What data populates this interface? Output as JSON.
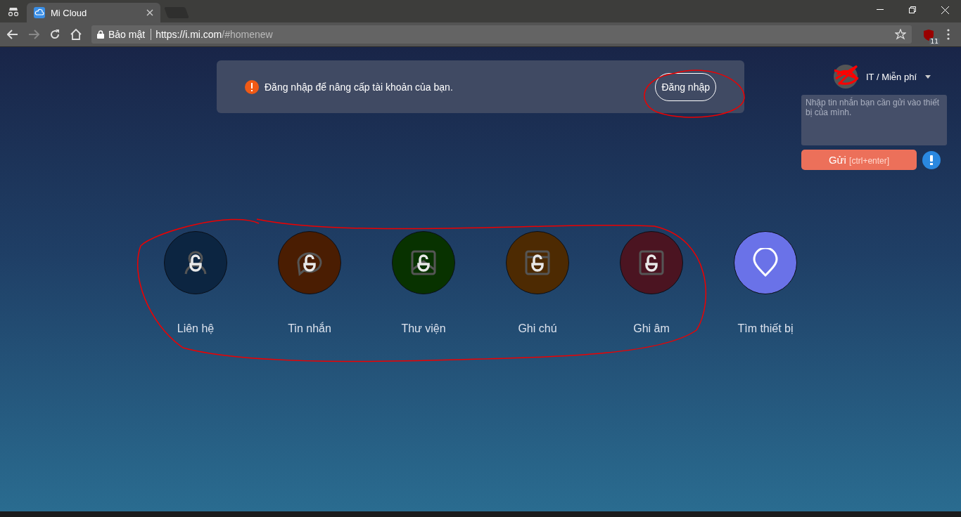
{
  "browser": {
    "tab_title": "Mi Cloud",
    "security_label": "Bảo mật",
    "url_host": "https://i.mi.com",
    "url_path": "/#homenew",
    "extension_badge": "11"
  },
  "notice": {
    "message": "Đăng nhập để nâng cấp tài khoản của bạn.",
    "button": "Đăng nhập"
  },
  "account": {
    "plan": "IT / Miễn phí"
  },
  "message_box": {
    "placeholder": "Nhập tin nhắn bạn cần gửi vào thiết bị của mình.",
    "send_label": "Gửi",
    "send_hint": "[ctrl+enter]"
  },
  "apps": [
    {
      "label": "Liên hệ",
      "kind": "contacts",
      "locked": true,
      "color": "#0c2541"
    },
    {
      "label": "Tin nhắn",
      "kind": "messages",
      "locked": true,
      "color": "#4a1d02"
    },
    {
      "label": "Thư viện",
      "kind": "gallery",
      "locked": true,
      "color": "#083200"
    },
    {
      "label": "Ghi chú",
      "kind": "notes",
      "locked": true,
      "color": "#4d2a02"
    },
    {
      "label": "Ghi âm",
      "kind": "recorder",
      "locked": true,
      "color": "#4b1421"
    },
    {
      "label": "Tìm thiết bị",
      "kind": "find",
      "locked": false,
      "color": "#6a72e8"
    }
  ]
}
